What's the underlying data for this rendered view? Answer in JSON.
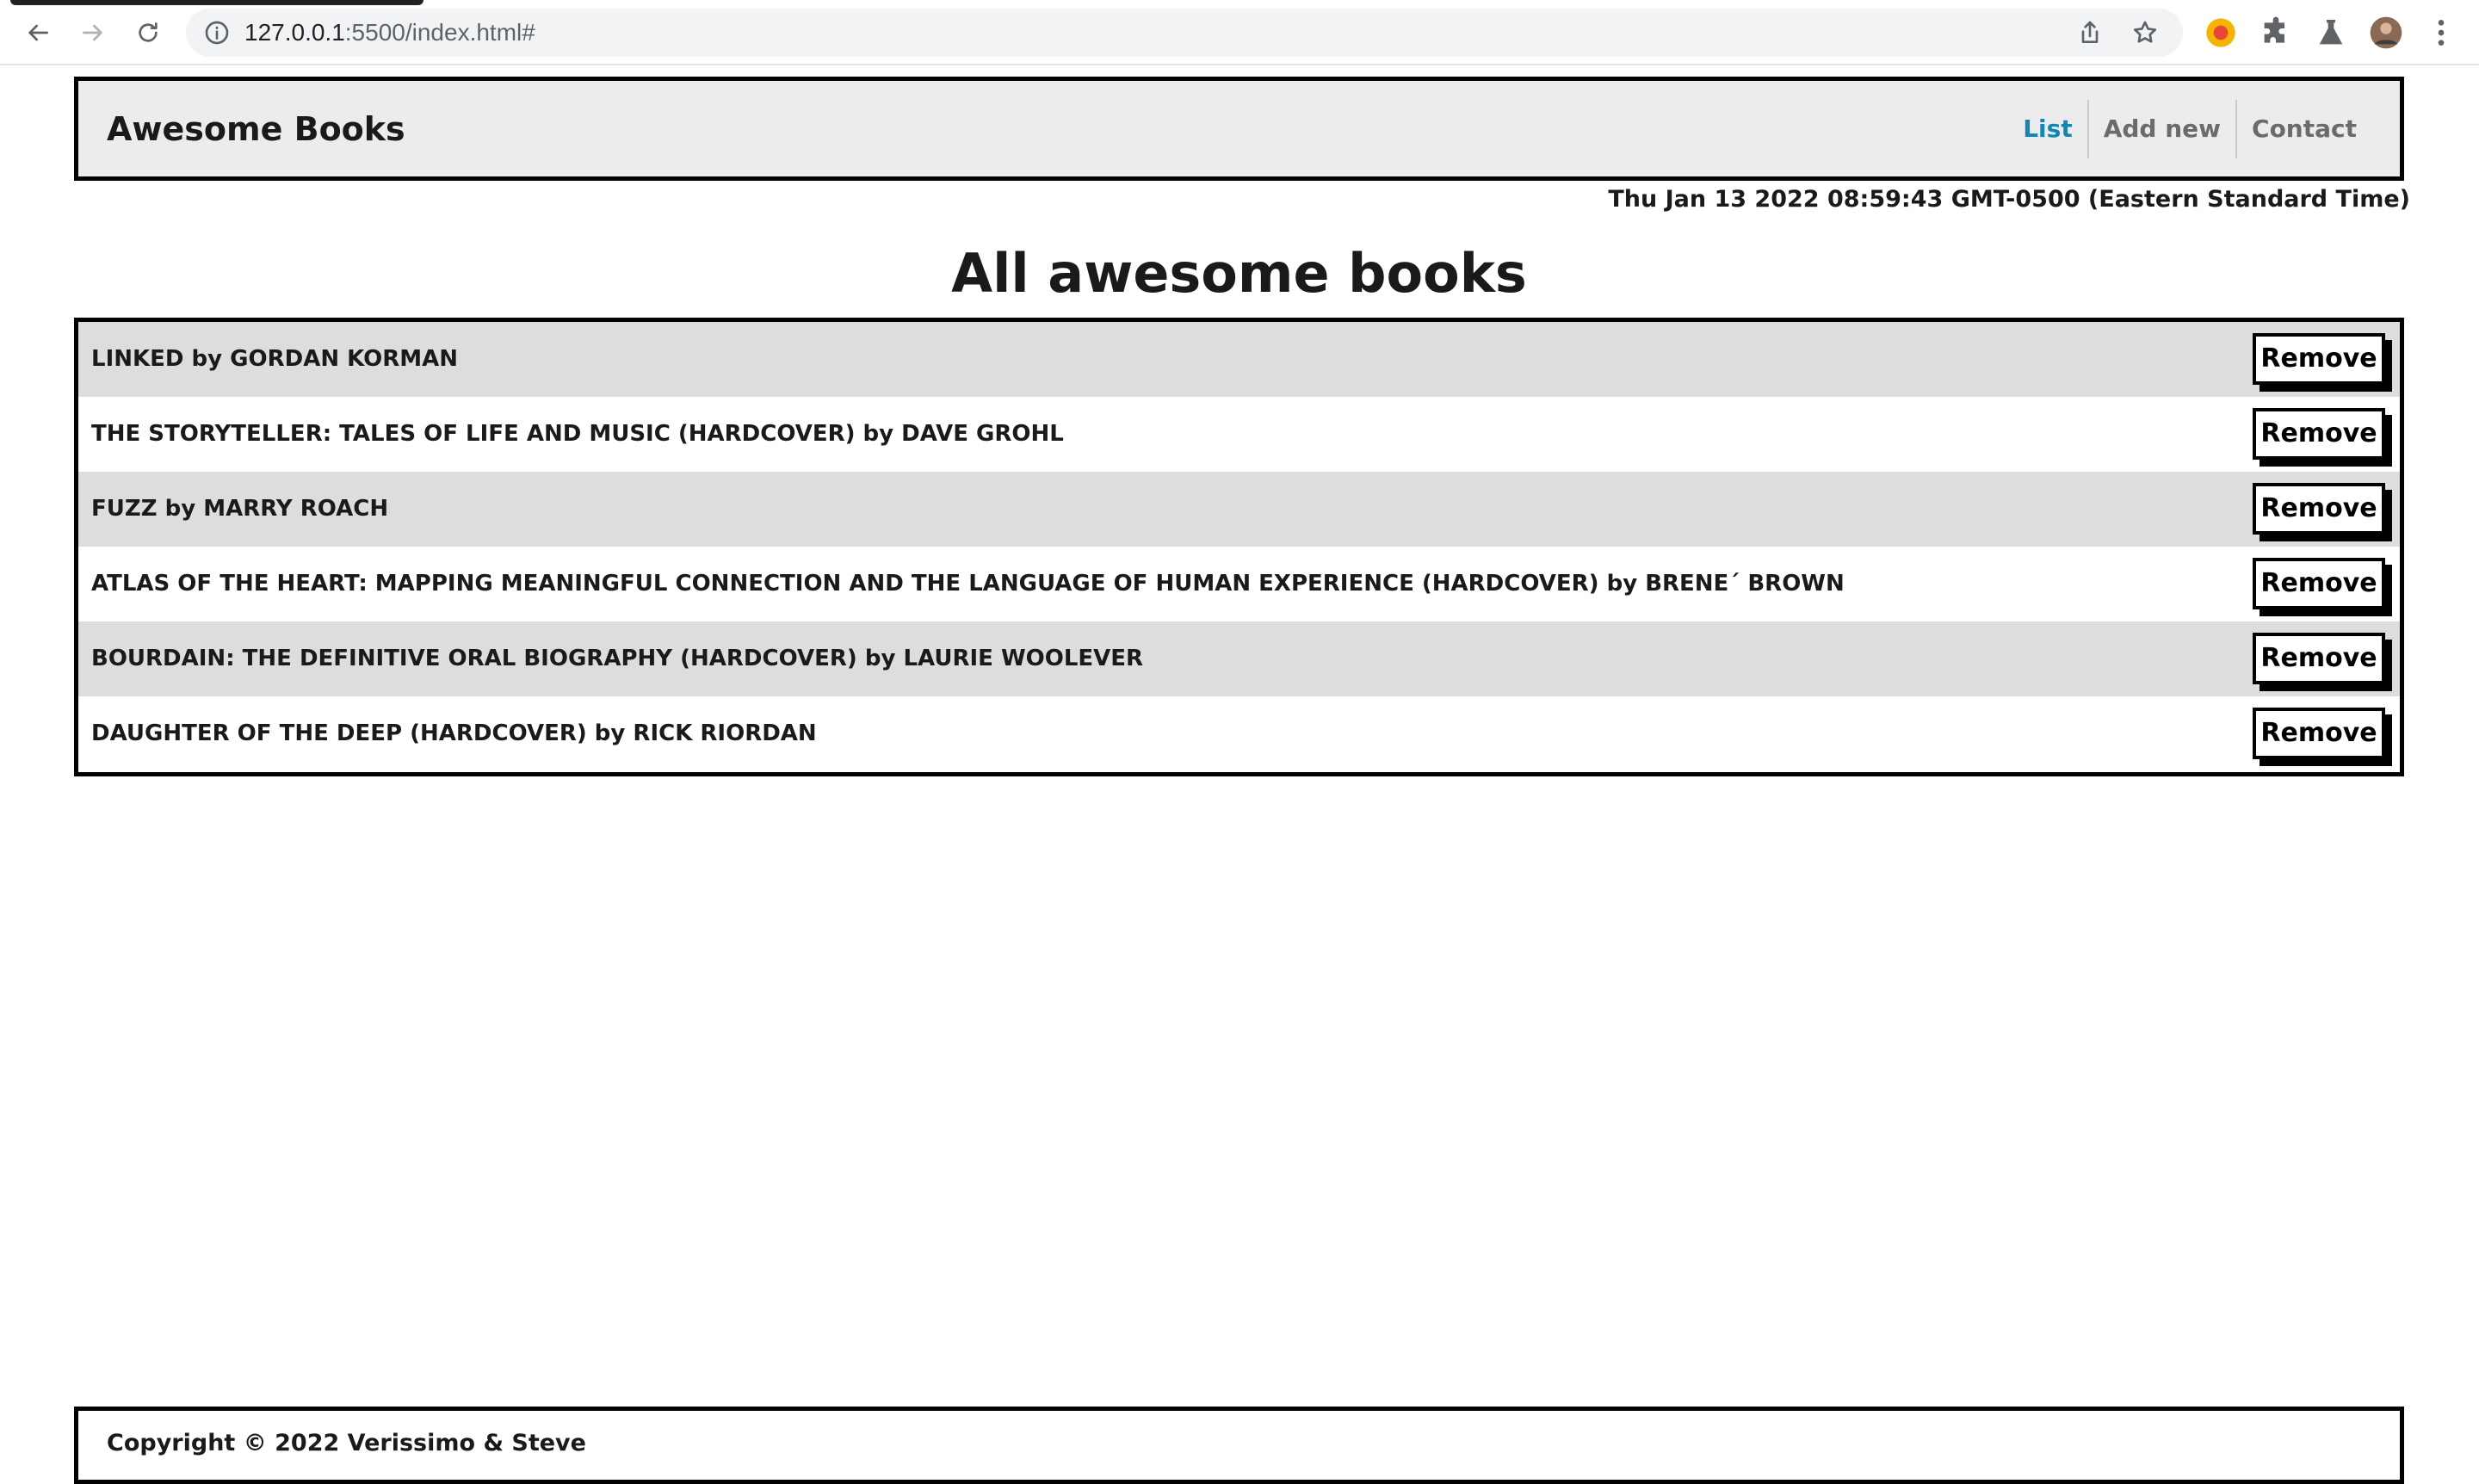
{
  "browser": {
    "url_host": "127.0.0.1",
    "url_rest": ":5500/index.html#"
  },
  "header": {
    "brand": "Awesome Books",
    "nav": [
      {
        "label": "List",
        "active": true
      },
      {
        "label": "Add new",
        "active": false
      },
      {
        "label": "Contact",
        "active": false
      }
    ]
  },
  "datetime": "Thu Jan 13 2022 08:59:43 GMT-0500 (Eastern Standard Time)",
  "main": {
    "title": "All awesome books",
    "remove_label": "Remove",
    "books": [
      "LINKED by GORDAN KORMAN",
      "THE STORYTELLER: TALES OF LIFE AND MUSIC (HARDCOVER) by DAVE GROHL",
      "FUZZ by MARRY ROACH",
      "ATLAS OF THE HEART: MAPPING MEANINGFUL CONNECTION AND THE LANGUAGE OF HUMAN EXPERIENCE (HARDCOVER) by BRENE´ BROWN",
      "BOURDAIN: THE DEFINITIVE ORAL BIOGRAPHY (HARDCOVER) by LAURIE WOOLEVER",
      "DAUGHTER OF THE DEEP (HARDCOVER) by RICK RIORDAN"
    ]
  },
  "footer": {
    "copyright": "Copyright © 2022 Verissimo & Steve"
  },
  "colors": {
    "active_link": "#1187b6",
    "header_bg": "#ececec",
    "odd_row_bg": "#dddddd"
  }
}
